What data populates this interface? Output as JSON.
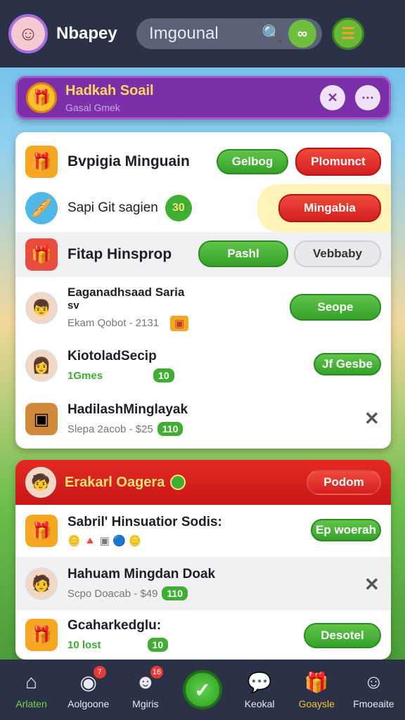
{
  "header": {
    "username": "Nbapey",
    "search_value": "Imgounal"
  },
  "banner": {
    "title": "Hadkah Soail",
    "subtitle": "Gasal Gmek"
  },
  "list": [
    {
      "title": "Bvpigia Minguain",
      "btn1": "Gelbog",
      "btn2": "Plomunct"
    },
    {
      "title": "Sapi Git sagien",
      "chip": "30",
      "btn1": "Mingabia"
    },
    {
      "title": "Fitap Hinsprop",
      "btn1": "Pashl",
      "btn2": "Vebbaby"
    },
    {
      "title": "Eaganadhsaad Saria",
      "title2": "sv",
      "sub": "Ekam Qobot - 2131",
      "btn1": "Seope"
    },
    {
      "title": "KiotoladSecip",
      "sub": "1Gmes",
      "chip": "10",
      "btn1": "Jf Gesbe"
    },
    {
      "title": "HadilashMinglayak",
      "sub": "Slepa 2acob - $25",
      "chip": "110"
    }
  ],
  "section2": {
    "title": "Erakarl Oagera",
    "head_button": "Podom",
    "rows": [
      {
        "title": "Sabril' Hinsuatior Sodis:",
        "btn1": "Ep woerah"
      },
      {
        "title": "Hahuam Mingdan Doak",
        "sub": "Scpo Doacab - $49",
        "chip": "110"
      },
      {
        "title": "Gcaharkedglu:",
        "sub": "10 lost",
        "chip": "10",
        "btn1": "Desotel"
      }
    ]
  },
  "nav": [
    {
      "label": "Arlaten",
      "icon": "home-icon"
    },
    {
      "label": "Aolgoone",
      "icon": "camera-icon",
      "badge": "7"
    },
    {
      "label": "Mgiris",
      "icon": "cat-icon",
      "badge": "16"
    },
    {
      "label": "",
      "icon": "check-icon"
    },
    {
      "label": "Keokal",
      "icon": "chat-icon"
    },
    {
      "label": "Goaysle",
      "icon": "gift-icon"
    },
    {
      "label": "Fmoeaite",
      "icon": "face-icon"
    }
  ]
}
